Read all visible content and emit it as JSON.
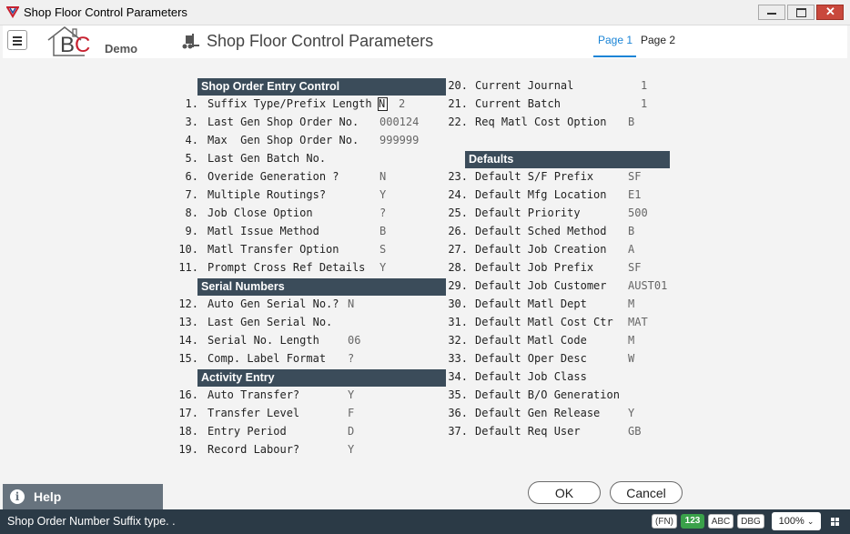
{
  "window": {
    "title": "Shop Floor Control Parameters"
  },
  "header": {
    "logo_text": "BC",
    "logo_demo": "Demo",
    "page_title": "Shop Floor Control Parameters",
    "tabs": [
      {
        "label": "Page 1",
        "active": true
      },
      {
        "label": "Page 2",
        "active": false
      }
    ]
  },
  "sections": {
    "shop_order": "Shop Order Entry Control",
    "serial": "Serial Numbers",
    "activity": "Activity Entry",
    "defaults": "Defaults"
  },
  "left_fields": [
    {
      "num": "1.",
      "label": "Suffix Type/Prefix Length",
      "value": "N",
      "value2": "2"
    },
    {
      "num": "3.",
      "label": "Last Gen Shop Order No.",
      "value": "000124"
    },
    {
      "num": "4.",
      "label": "Max  Gen Shop Order No.",
      "value": "999999"
    },
    {
      "num": "5.",
      "label": "Last Gen Batch No.",
      "value": ""
    },
    {
      "num": "6.",
      "label": "Overide Generation ?",
      "value": "N"
    },
    {
      "num": "7.",
      "label": "Multiple Routings?",
      "value": "Y"
    },
    {
      "num": "8.",
      "label": "Job Close Option",
      "value": "?"
    },
    {
      "num": "9.",
      "label": "Matl Issue Method",
      "value": "B"
    },
    {
      "num": "10.",
      "label": "Matl Transfer Option",
      "value": "S"
    },
    {
      "num": "11.",
      "label": "Prompt Cross Ref Details",
      "value": "Y"
    },
    {
      "num": "12.",
      "label": "Auto Gen Serial No.?",
      "value": "N"
    },
    {
      "num": "13.",
      "label": "Last Gen Serial No.",
      "value": ""
    },
    {
      "num": "14.",
      "label": "Serial No. Length",
      "value": "06"
    },
    {
      "num": "15.",
      "label": "Comp. Label Format",
      "value": "?"
    },
    {
      "num": "16.",
      "label": "Auto Transfer?",
      "value": "Y"
    },
    {
      "num": "17.",
      "label": "Transfer Level",
      "value": "F"
    },
    {
      "num": "18.",
      "label": "Entry Period",
      "value": "D"
    },
    {
      "num": "19.",
      "label": "Record Labour?",
      "value": "Y"
    }
  ],
  "right_fields": [
    {
      "num": "20.",
      "label": "Current Journal",
      "value": "1"
    },
    {
      "num": "21.",
      "label": "Current Batch",
      "value": "1"
    },
    {
      "num": "22.",
      "label": "Req Matl Cost Option",
      "value": "B"
    },
    {
      "num": "23.",
      "label": "Default S/F Prefix",
      "value": "SF"
    },
    {
      "num": "24.",
      "label": "Default Mfg Location",
      "value": "E1"
    },
    {
      "num": "25.",
      "label": "Default Priority",
      "value": "500"
    },
    {
      "num": "26.",
      "label": "Default Sched Method",
      "value": "B"
    },
    {
      "num": "27.",
      "label": "Default Job Creation",
      "value": "A"
    },
    {
      "num": "28.",
      "label": "Default Job Prefix",
      "value": "SF"
    },
    {
      "num": "29.",
      "label": "Default Job Customer",
      "value": "AUST01"
    },
    {
      "num": "30.",
      "label": "Default Matl Dept",
      "value": "M"
    },
    {
      "num": "31.",
      "label": "Default Matl Cost Ctr",
      "value": "MAT"
    },
    {
      "num": "32.",
      "label": "Default Matl Code",
      "value": "M"
    },
    {
      "num": "33.",
      "label": "Default Oper Desc",
      "value": "W"
    },
    {
      "num": "34.",
      "label": "Default Job Class",
      "value": ""
    },
    {
      "num": "35.",
      "label": "Default B/O Generation",
      "value": ""
    },
    {
      "num": "36.",
      "label": "Default Gen Release",
      "value": "Y"
    },
    {
      "num": "37.",
      "label": "Default Req User",
      "value": "GB"
    }
  ],
  "help": {
    "label": "Help",
    "icon": "info-icon"
  },
  "buttons": {
    "ok": "OK",
    "cancel": "Cancel"
  },
  "status": {
    "message": "Shop Order Number Suffix type. .",
    "chips": [
      "(FN)",
      "123",
      "ABC",
      "DBG"
    ],
    "zoom": "100%"
  },
  "colors": {
    "accent": "#1a84d6",
    "section_header": "#3b4c5a",
    "status_bar": "#2b3a46",
    "help_bg": "#67737e",
    "chip_green": "#3aa14a"
  }
}
